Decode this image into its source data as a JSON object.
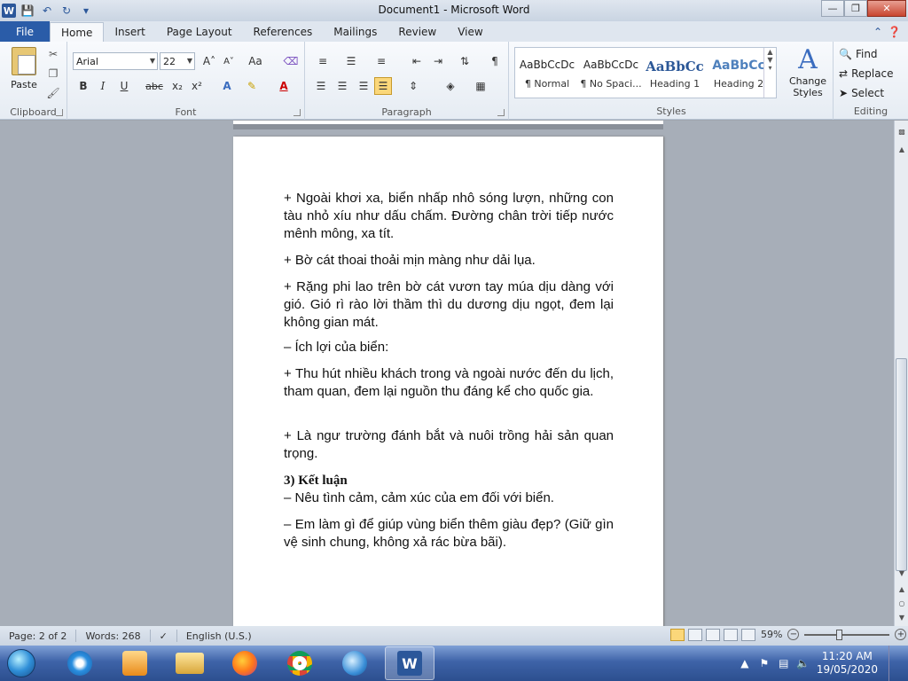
{
  "window": {
    "title": "Document1  -  Microsoft Word",
    "app_letter": "W"
  },
  "tabs": [
    "File",
    "Home",
    "Insert",
    "Page Layout",
    "References",
    "Mailings",
    "Review",
    "View"
  ],
  "ribbon": {
    "clipboard": {
      "paste": "Paste",
      "label": "Clipboard"
    },
    "font": {
      "family": "Arial",
      "size": "22",
      "grow": "A˄",
      "shrink": "A˅",
      "change_case": "Aa",
      "bold": "B",
      "italic": "I",
      "underline": "U",
      "strike": "abc",
      "subscript": "x₂",
      "superscript": "x²",
      "label": "Font"
    },
    "paragraph": {
      "label": "Paragraph"
    },
    "styles": {
      "label": "Styles",
      "items": [
        {
          "sample": "AaBbCcDc",
          "name": "¶ Normal"
        },
        {
          "sample": "AaBbCcDc",
          "name": "¶ No Spaci..."
        },
        {
          "sample": "AaBbCc",
          "name": "Heading 1"
        },
        {
          "sample": "AaBbCc",
          "name": "Heading 2"
        }
      ],
      "change_styles": "Change Styles"
    },
    "editing": {
      "label": "Editing",
      "find": "Find",
      "replace": "Replace",
      "select": "Select"
    }
  },
  "document": {
    "paragraphs": [
      "+ Ngoài khơi xa, biển nhấp nhô sóng lượn, những con tàu nhỏ xíu như dấu chấm. Đường chân trời tiếp nước mênh mông, xa tít.",
      "+ Bờ cát thoai thoải mịn màng như dải lụa.",
      "+ Rặng phi lao trên bờ cát vươn tay múa dịu dàng với gió. Gió rì rào lời thầm thì du dương dịu ngọt, đem lại không gian mát.",
      "– Ích lợi của biển:",
      "+ Thu hút nhiều khách trong và ngoài nước đến du lịch, tham quan, đem lại nguồn thu đáng kể cho quốc gia.",
      "+ Là ngư trường đánh bắt và nuôi trồng hải sản quan trọng.",
      "3) Kết luận",
      "– Nêu tình cảm, cảm xúc của em đối với biển.",
      "– Em làm gì để giúp vùng biển thêm giàu đẹp? (Giữ gìn vệ sinh chung, không xả rác bừa bãi)."
    ]
  },
  "status": {
    "page": "Page: 2 of 2",
    "words": "Words: 268",
    "language": "English (U.S.)",
    "zoom": "59%"
  },
  "taskbar": {
    "time": "11:20 AM",
    "date": "19/05/2020"
  },
  "colors": {
    "file_tab": "#2a5ca8",
    "accent": "#2b579a"
  }
}
